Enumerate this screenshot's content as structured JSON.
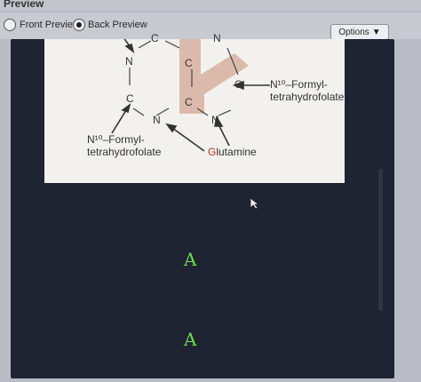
{
  "window": {
    "title": "Preview"
  },
  "toolbar": {
    "front_preview_label": "Front Preview",
    "back_preview_label": "Back Preview",
    "selected": "Back Preview",
    "options_label": "Options",
    "options_arrow": "▼"
  },
  "diagram": {
    "atoms": {
      "n_top": "N",
      "n_left": "N",
      "c_top_left": "C",
      "c_top_mid": "C",
      "c_mid_left": "C",
      "c_mid_mid": "C",
      "n_bottom_mid": "N",
      "n_bottom_right": "N",
      "c_right": "C"
    },
    "formyl_right_line1": "N¹⁰–Formyl-",
    "formyl_right_line2": "tetrahydrofolate",
    "formyl_left_line1": "N¹⁰–Formyl-",
    "formyl_left_line2": "tetrahydrofolate",
    "glutamine_first": "G",
    "glutamine_rest": "lutamine"
  },
  "answers": {
    "first": "A",
    "second": "A"
  },
  "colors": {
    "answer_text": "#6fdc4a",
    "highlight_band": "#d8b4a4",
    "glutamine_G": "#c62828",
    "preview_bg": "#1f2433"
  }
}
